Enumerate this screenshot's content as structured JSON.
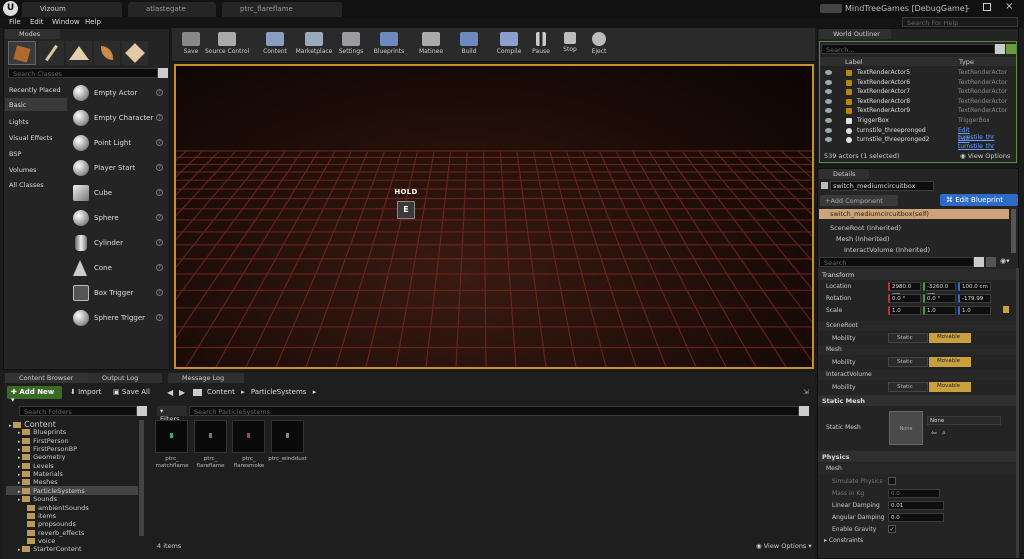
{
  "titlebar": {
    "tabs": [
      "Vizoum",
      "atlastegate",
      "ptrc_flareflame"
    ],
    "app_title": "MindTreeGames [DebugGame]",
    "search_help": "Search For Help"
  },
  "menu": [
    "File",
    "Edit",
    "Window",
    "Help"
  ],
  "modes": {
    "tab": "Modes",
    "search_placeholder": "Search Classes",
    "categories": [
      "Recently Placed",
      "Basic",
      "Lights",
      "Visual Effects",
      "BSP",
      "Volumes",
      "All Classes"
    ],
    "items": [
      "Empty Actor",
      "Empty Character",
      "Point Light",
      "Player Start",
      "Cube",
      "Sphere",
      "Cylinder",
      "Cone",
      "Box Trigger",
      "Sphere Trigger"
    ]
  },
  "toolbar": [
    "Save",
    "Source Control",
    "Content",
    "Marketplace",
    "Settings",
    "Blueprints",
    "Matinee",
    "Build",
    "Compile",
    "Pause",
    "Stop",
    "Eject"
  ],
  "viewport": {
    "prompt_title": "HOLD",
    "prompt_key": "E"
  },
  "outliner": {
    "tab": "World Outliner",
    "search_placeholder": "Search...",
    "col_label": "Label",
    "col_type": "Type",
    "rows": [
      {
        "label": "TextRenderActor5",
        "type": "TextRenderActor"
      },
      {
        "label": "TextRenderActor6",
        "type": "TextRenderActor"
      },
      {
        "label": "TextRenderActor7",
        "type": "TextRenderActor"
      },
      {
        "label": "TextRenderActor8",
        "type": "TextRenderActor"
      },
      {
        "label": "TextRenderActor9",
        "type": "TextRenderActor"
      },
      {
        "label": "TriggerBox",
        "type": "TriggerBox"
      },
      {
        "label": "turnstile_threepronged",
        "type": "Edit turnstile_thr"
      },
      {
        "label": "turnstile_threepronged2",
        "type": "Edit turnstile_thr"
      }
    ],
    "status": "539 actors (1 selected)",
    "view_options": "View Options"
  },
  "details": {
    "tab": "Details",
    "name": "switch_mediumcircuitbox",
    "add_component": "+Add Component",
    "edit_blueprint": "Edit Blueprint",
    "self_row": "switch_mediumcircuitbox(self)",
    "components": [
      "SceneRoot (Inherited)",
      "Mesh (Inherited)",
      "InteractVolume (Inherited)"
    ],
    "search_placeholder": "Search",
    "transform": {
      "header": "Transform",
      "location_label": "Location",
      "location": [
        "2980.0 cm",
        "-3260.0 cm",
        "100.0 cm"
      ],
      "rotation_label": "Rotation",
      "rotation": [
        "0.0 °",
        "0.0 °",
        "-179.99"
      ],
      "scale_label": "Scale",
      "scale": [
        "1.0",
        "1.0",
        "1.0"
      ]
    },
    "mobility_sections": [
      "SceneRoot",
      "Mesh",
      "InteractVolume"
    ],
    "mobility_label": "Mobility",
    "static": "Static",
    "movable": "Movable",
    "static_mesh_header": "Static Mesh",
    "static_mesh_label": "Static Mesh",
    "static_mesh_value": "None",
    "static_mesh_thumb": "None",
    "physics_header": "Physics",
    "physics_sub": "Mesh",
    "physics_rows": [
      {
        "label": "Simulate Physics",
        "value": ""
      },
      {
        "label": "Mass in Kg",
        "value": "0.0"
      },
      {
        "label": "Linear Damping",
        "value": "0.01"
      },
      {
        "label": "Angular Damping",
        "value": "0.0"
      },
      {
        "label": "Enable Gravity",
        "value": ""
      }
    ],
    "constraints": "Constraints"
  },
  "bottom_tabs": [
    "Content Browser",
    "Output Log",
    "Message Log"
  ],
  "content": {
    "add_new": "Add New",
    "import": "Import",
    "save_all": "Save All",
    "search_folders": "Search Folders",
    "path": [
      "Content",
      "ParticleSystems"
    ],
    "filters": "Filters",
    "search_assets": "Search ParticleSystems",
    "tree": [
      {
        "name": "Content",
        "depth": 0
      },
      {
        "name": "Blueprints",
        "depth": 1
      },
      {
        "name": "FirstPerson",
        "depth": 1
      },
      {
        "name": "FirstPersonBP",
        "depth": 1
      },
      {
        "name": "Geometry",
        "depth": 1
      },
      {
        "name": "Levels",
        "depth": 1
      },
      {
        "name": "Materials",
        "depth": 1
      },
      {
        "name": "Meshes",
        "depth": 1
      },
      {
        "name": "ParticleSystems",
        "depth": 1
      },
      {
        "name": "Sounds",
        "depth": 1
      },
      {
        "name": "ambientSounds",
        "depth": 2
      },
      {
        "name": "items",
        "depth": 2
      },
      {
        "name": "propsounds",
        "depth": 2
      },
      {
        "name": "reverb_effects",
        "depth": 2
      },
      {
        "name": "voice",
        "depth": 2
      },
      {
        "name": "StarterContent",
        "depth": 1
      }
    ],
    "assets": [
      [
        "ptrc_",
        "matchflame"
      ],
      [
        "ptrc_",
        "flareflame"
      ],
      [
        "ptrc_",
        "flaresmoke"
      ],
      [
        "ptrc_winddust",
        ""
      ]
    ],
    "count": "4 items",
    "view_options": "View Options"
  },
  "colors": {
    "accent_green": "#3a6b24",
    "edit_blueprint": "#2c6cc6",
    "movable": "#caa03e",
    "selected_row": "#cda47a"
  }
}
